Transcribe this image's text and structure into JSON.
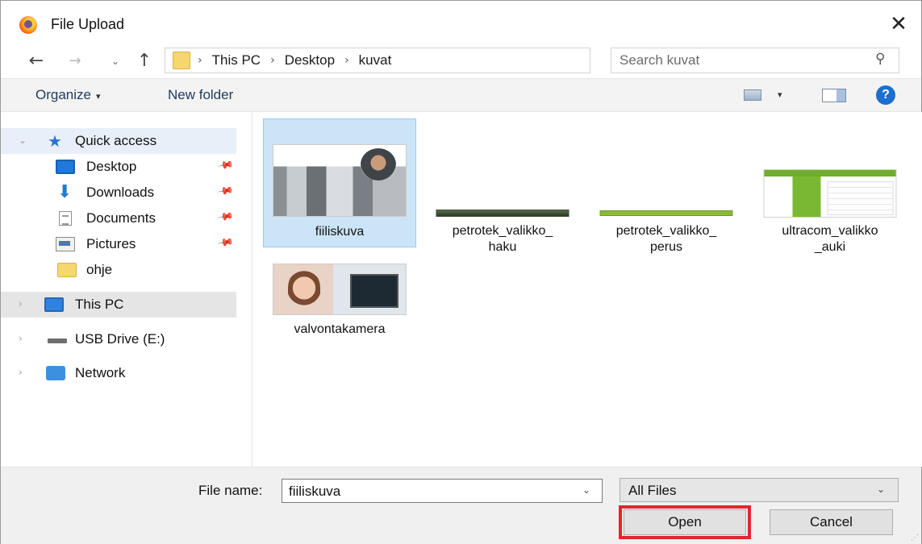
{
  "window": {
    "title": "File Upload",
    "close_symbol": "✕"
  },
  "nav": {
    "back_symbol": "←",
    "forward_symbol": "→",
    "recent_symbol": "⌄",
    "up_symbol": "↑",
    "breadcrumb": [
      "This PC",
      "Desktop",
      "kuvat"
    ],
    "crumb_separator": "›",
    "dropdown_symbol": "⌄",
    "refresh_symbol": "↻"
  },
  "search": {
    "placeholder": "Search kuvat",
    "icon_symbol": "⚲"
  },
  "toolbar": {
    "organize_label": "Organize",
    "organize_caret": "▾",
    "new_folder_label": "New folder",
    "view_caret": "▾",
    "help_label": "?"
  },
  "sidebar": {
    "pin_symbol": "📌",
    "expander_symbol": "›",
    "expander_open_symbol": "⌄",
    "quick_access": "Quick access",
    "star_symbol": "★",
    "download_symbol": "⬇",
    "items": [
      {
        "label": "Desktop",
        "icon": "desktop-icon",
        "pinned": true
      },
      {
        "label": "Downloads",
        "icon": "downloads-icon",
        "pinned": true
      },
      {
        "label": "Documents",
        "icon": "documents-icon",
        "pinned": true
      },
      {
        "label": "Pictures",
        "icon": "pictures-icon",
        "pinned": true
      },
      {
        "label": "ohje",
        "icon": "folder-icon",
        "pinned": false
      }
    ],
    "this_pc": "This PC",
    "usb": "USB Drive (E:)",
    "network": "Network"
  },
  "files": [
    {
      "name": "fiiliskuva",
      "selected": true
    },
    {
      "name": "petrotek_valikko_\nhaku",
      "line1": "petrotek_valikko_",
      "line2": "haku",
      "selected": false
    },
    {
      "name": "petrotek_valikko_\nperus",
      "line1": "petrotek_valikko_",
      "line2": "perus",
      "selected": false
    },
    {
      "name": "ultracom_valikko\n_auki",
      "line1": "ultracom_valikko",
      "line2": "_auki",
      "selected": false
    },
    {
      "name": "valvontakamera",
      "selected": false
    }
  ],
  "bottom": {
    "file_name_label": "File name:",
    "file_name_value": "fiiliskuva",
    "file_type_value": "All Files",
    "caret_symbol": "⌄",
    "open_label": "Open",
    "cancel_label": "Cancel",
    "grip_symbol": "⋰"
  },
  "colors": {
    "selection": "#cce4f7",
    "highlight_border": "#e0282e",
    "accent": "#1d6fcf"
  }
}
